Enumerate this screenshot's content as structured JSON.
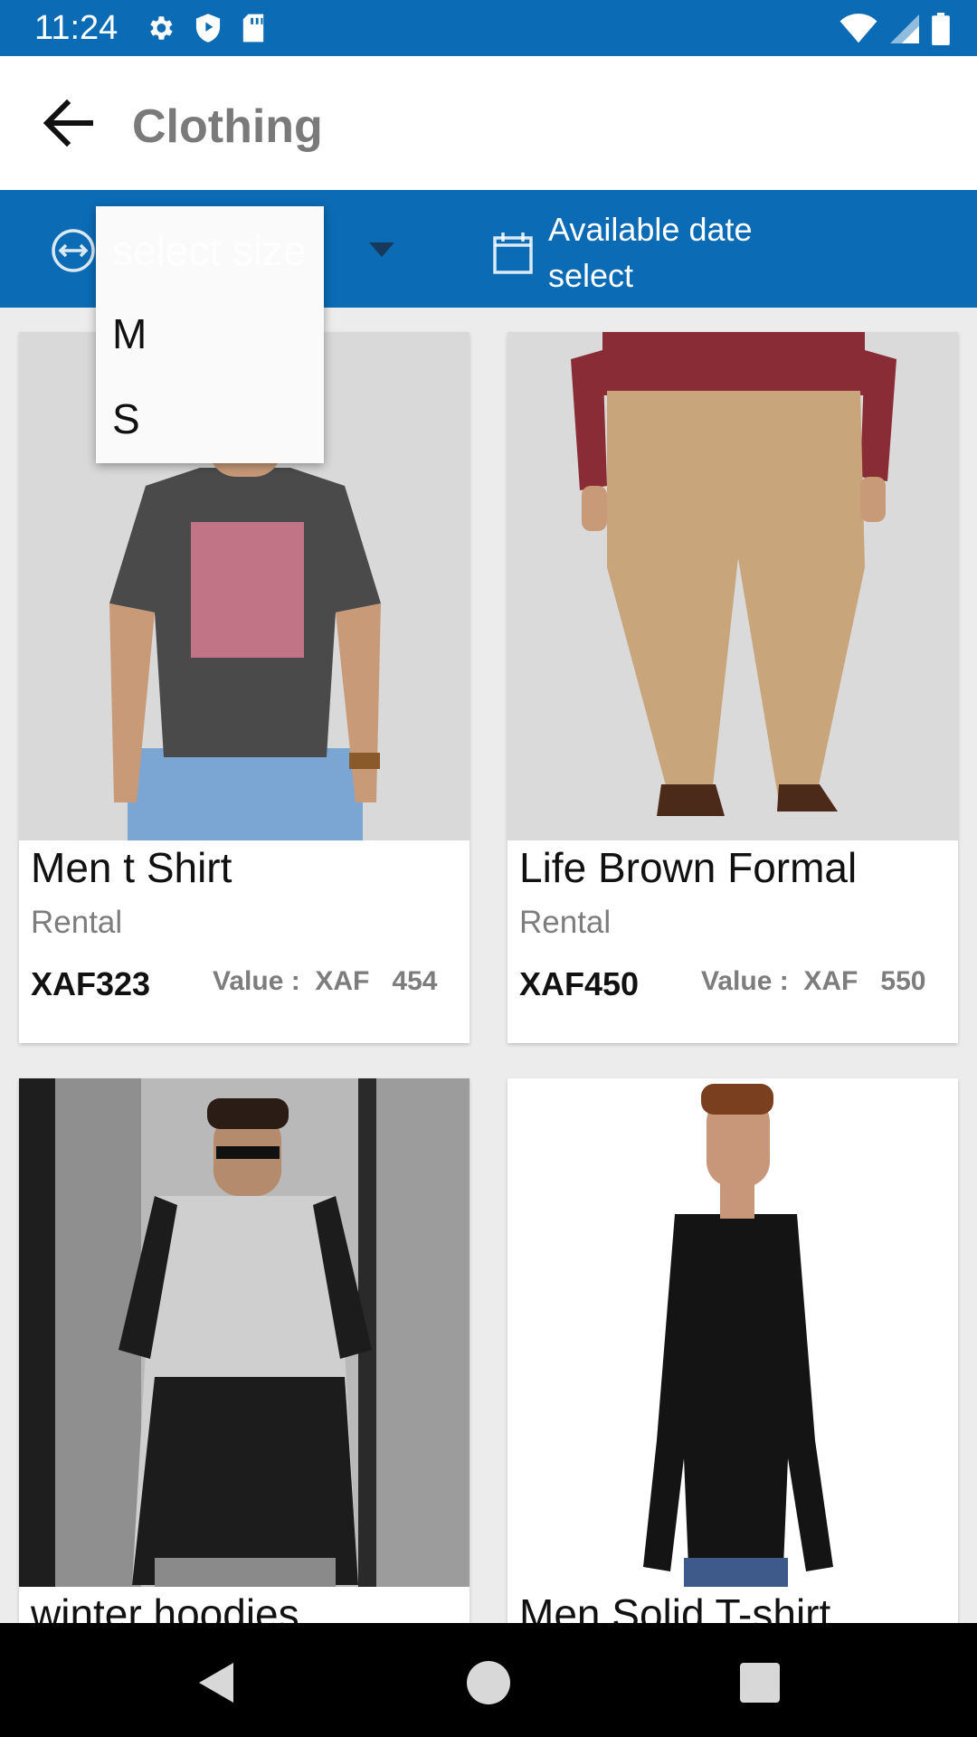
{
  "status_bar": {
    "time": "11:24",
    "left_icons": [
      "gear-icon",
      "shield-icon",
      "sd-card-icon"
    ],
    "right_icons": [
      "wifi-icon",
      "signal-icon",
      "battery-icon"
    ]
  },
  "app_bar": {
    "title": "Clothing",
    "back_icon": "arrow-left-icon"
  },
  "filters": {
    "size_icon": "horizontal-arrows-icon",
    "size_placeholder": "select size",
    "size_options": [
      "M",
      "S"
    ],
    "date_icon": "calendar-icon",
    "date_label_line1": "Available date",
    "date_label_line2": "select"
  },
  "products": [
    {
      "name": "Men t Shirt",
      "type": "Rental",
      "price": "XAF323",
      "value": "Value :  XAF   454"
    },
    {
      "name": "Life Brown Formal",
      "type": "Rental",
      "price": "XAF450",
      "value": "Value :  XAF   550"
    },
    {
      "name": "winter hoodies",
      "type": "",
      "price": "",
      "value": ""
    },
    {
      "name": "Men Solid T-shirt",
      "type": "",
      "price": "",
      "value": ""
    }
  ],
  "nav_bar": {
    "buttons": [
      "back-triangle-icon",
      "home-circle-icon",
      "recents-square-icon"
    ]
  },
  "colors": {
    "primary": "#0b6bb5",
    "app_bar_bg": "#ffffff",
    "title_gray": "#7a7a7a"
  }
}
